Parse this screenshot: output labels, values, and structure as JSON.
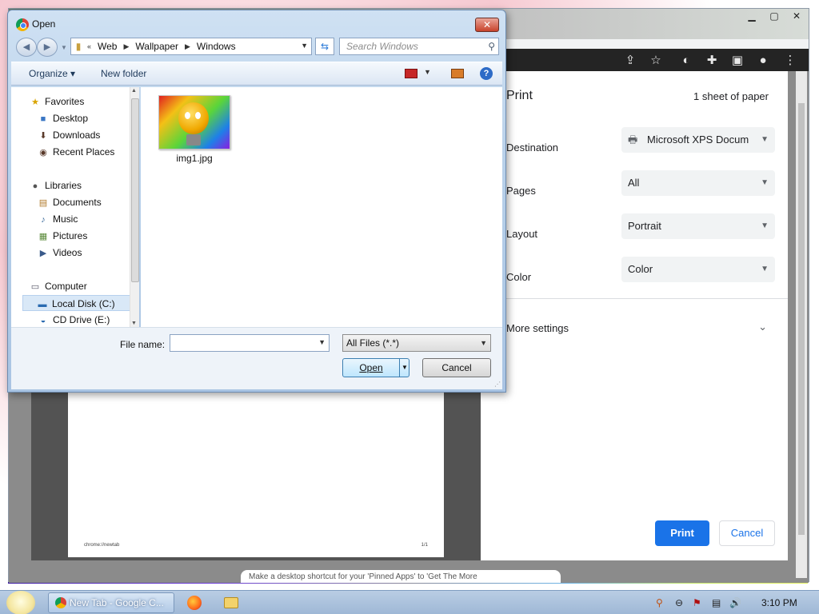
{
  "chrome": {
    "print_title": "Print",
    "sheets": "1 sheet of paper",
    "rows": [
      {
        "label": "Destination",
        "value": "Microsoft XPS Docum"
      },
      {
        "label": "Pages",
        "value": "All"
      },
      {
        "label": "Layout",
        "value": "Portrait"
      },
      {
        "label": "Color",
        "value": "Color"
      }
    ],
    "more_settings": "More settings",
    "print_button": "Print",
    "cancel_button": "Cancel",
    "preview_footer_left": "chrome://newtab",
    "preview_footer_right": "1/1",
    "bottom_text": "Make a desktop shortcut for your 'Pinned Apps' to 'Get The More"
  },
  "dialog": {
    "title": "Open",
    "breadcrumb": [
      "Web",
      "Wallpaper",
      "Windows"
    ],
    "search_placeholder": "Search Windows",
    "toolbar": {
      "organize": "Organize",
      "new_folder": "New folder"
    },
    "nav": {
      "favorites": "Favorites",
      "desktop": "Desktop",
      "downloads": "Downloads",
      "recent_places": "Recent Places",
      "libraries": "Libraries",
      "documents": "Documents",
      "music": "Music",
      "pictures": "Pictures",
      "videos": "Videos",
      "computer": "Computer",
      "local_disk": "Local Disk (C:)",
      "cd_drive": "CD Drive (E:)"
    },
    "files": [
      {
        "name": "img1.jpg"
      }
    ],
    "file_name_label": "File name:",
    "file_name_value": "",
    "filter": "All Files (*.*)",
    "open_button": "Open",
    "cancel_button": "Cancel"
  },
  "taskbar": {
    "task_label": "New Tab - Google C...",
    "clock": "3:10 PM"
  }
}
